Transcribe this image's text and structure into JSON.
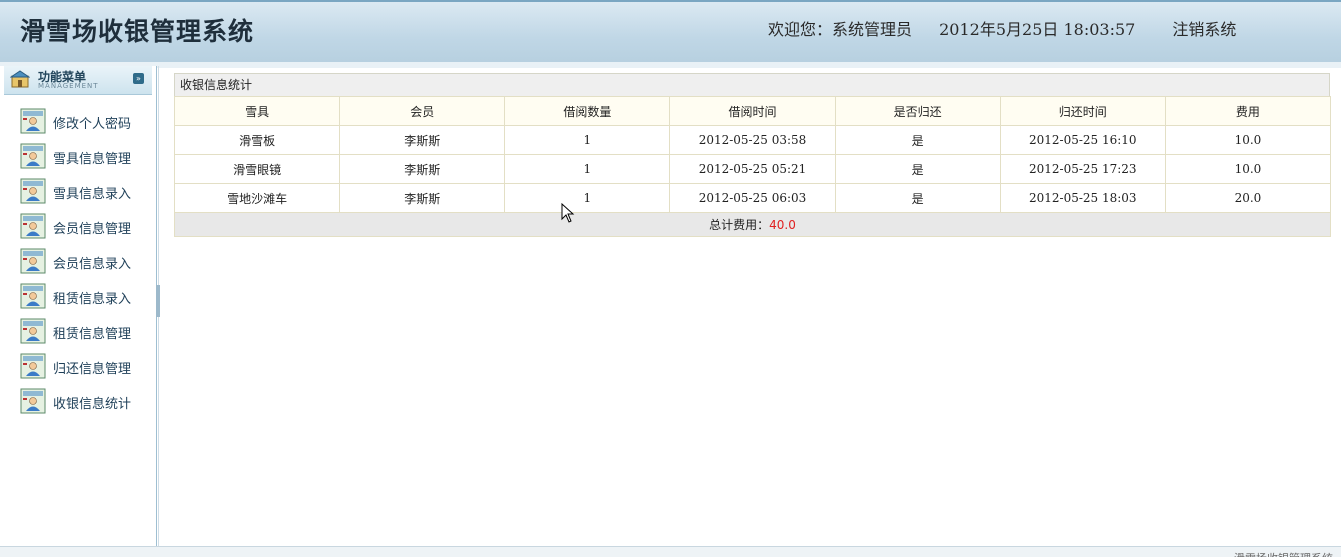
{
  "header": {
    "app_title": "滑雪场收银管理系统",
    "welcome": "欢迎您：系统管理员",
    "datetime": "2012年5月25日  18:03:57",
    "logout": "注销系统"
  },
  "sidebar": {
    "title": "功能菜单",
    "subtitle": "MANAGEMENT",
    "items": [
      {
        "label": "修改个人密码",
        "icon": "user-card-icon"
      },
      {
        "label": "雪具信息管理",
        "icon": "user-card-icon"
      },
      {
        "label": "雪具信息录入",
        "icon": "user-card-icon"
      },
      {
        "label": "会员信息管理",
        "icon": "user-card-icon"
      },
      {
        "label": "会员信息录入",
        "icon": "user-card-icon"
      },
      {
        "label": "租赁信息录入",
        "icon": "user-card-icon"
      },
      {
        "label": "租赁信息管理",
        "icon": "user-card-icon"
      },
      {
        "label": "归还信息管理",
        "icon": "user-card-icon"
      },
      {
        "label": "收银信息统计",
        "icon": "user-card-icon"
      }
    ]
  },
  "main": {
    "panel_title": "收银信息统计",
    "columns": [
      "雪具",
      "会员",
      "借阅数量",
      "借阅时间",
      "是否归还",
      "归还时间",
      "费用"
    ],
    "rows": [
      [
        "滑雪板",
        "李斯斯",
        "1",
        "2012-05-25 03:58",
        "是",
        "2012-05-25 16:10",
        "10.0"
      ],
      [
        "滑雪眼镜",
        "李斯斯",
        "1",
        "2012-05-25 05:21",
        "是",
        "2012-05-25 17:23",
        "10.0"
      ],
      [
        "雪地沙滩车",
        "李斯斯",
        "1",
        "2012-05-25 06:03",
        "是",
        "2012-05-25 18:03",
        "20.0"
      ]
    ],
    "total_label": "总计费用：",
    "total_value": "40.0"
  },
  "footer": {
    "text": "滑雪场收银管理系统"
  },
  "colors": {
    "header_bg": "#c0d7e6",
    "accent": "#2f6b8a",
    "total_value": "#e02020"
  }
}
